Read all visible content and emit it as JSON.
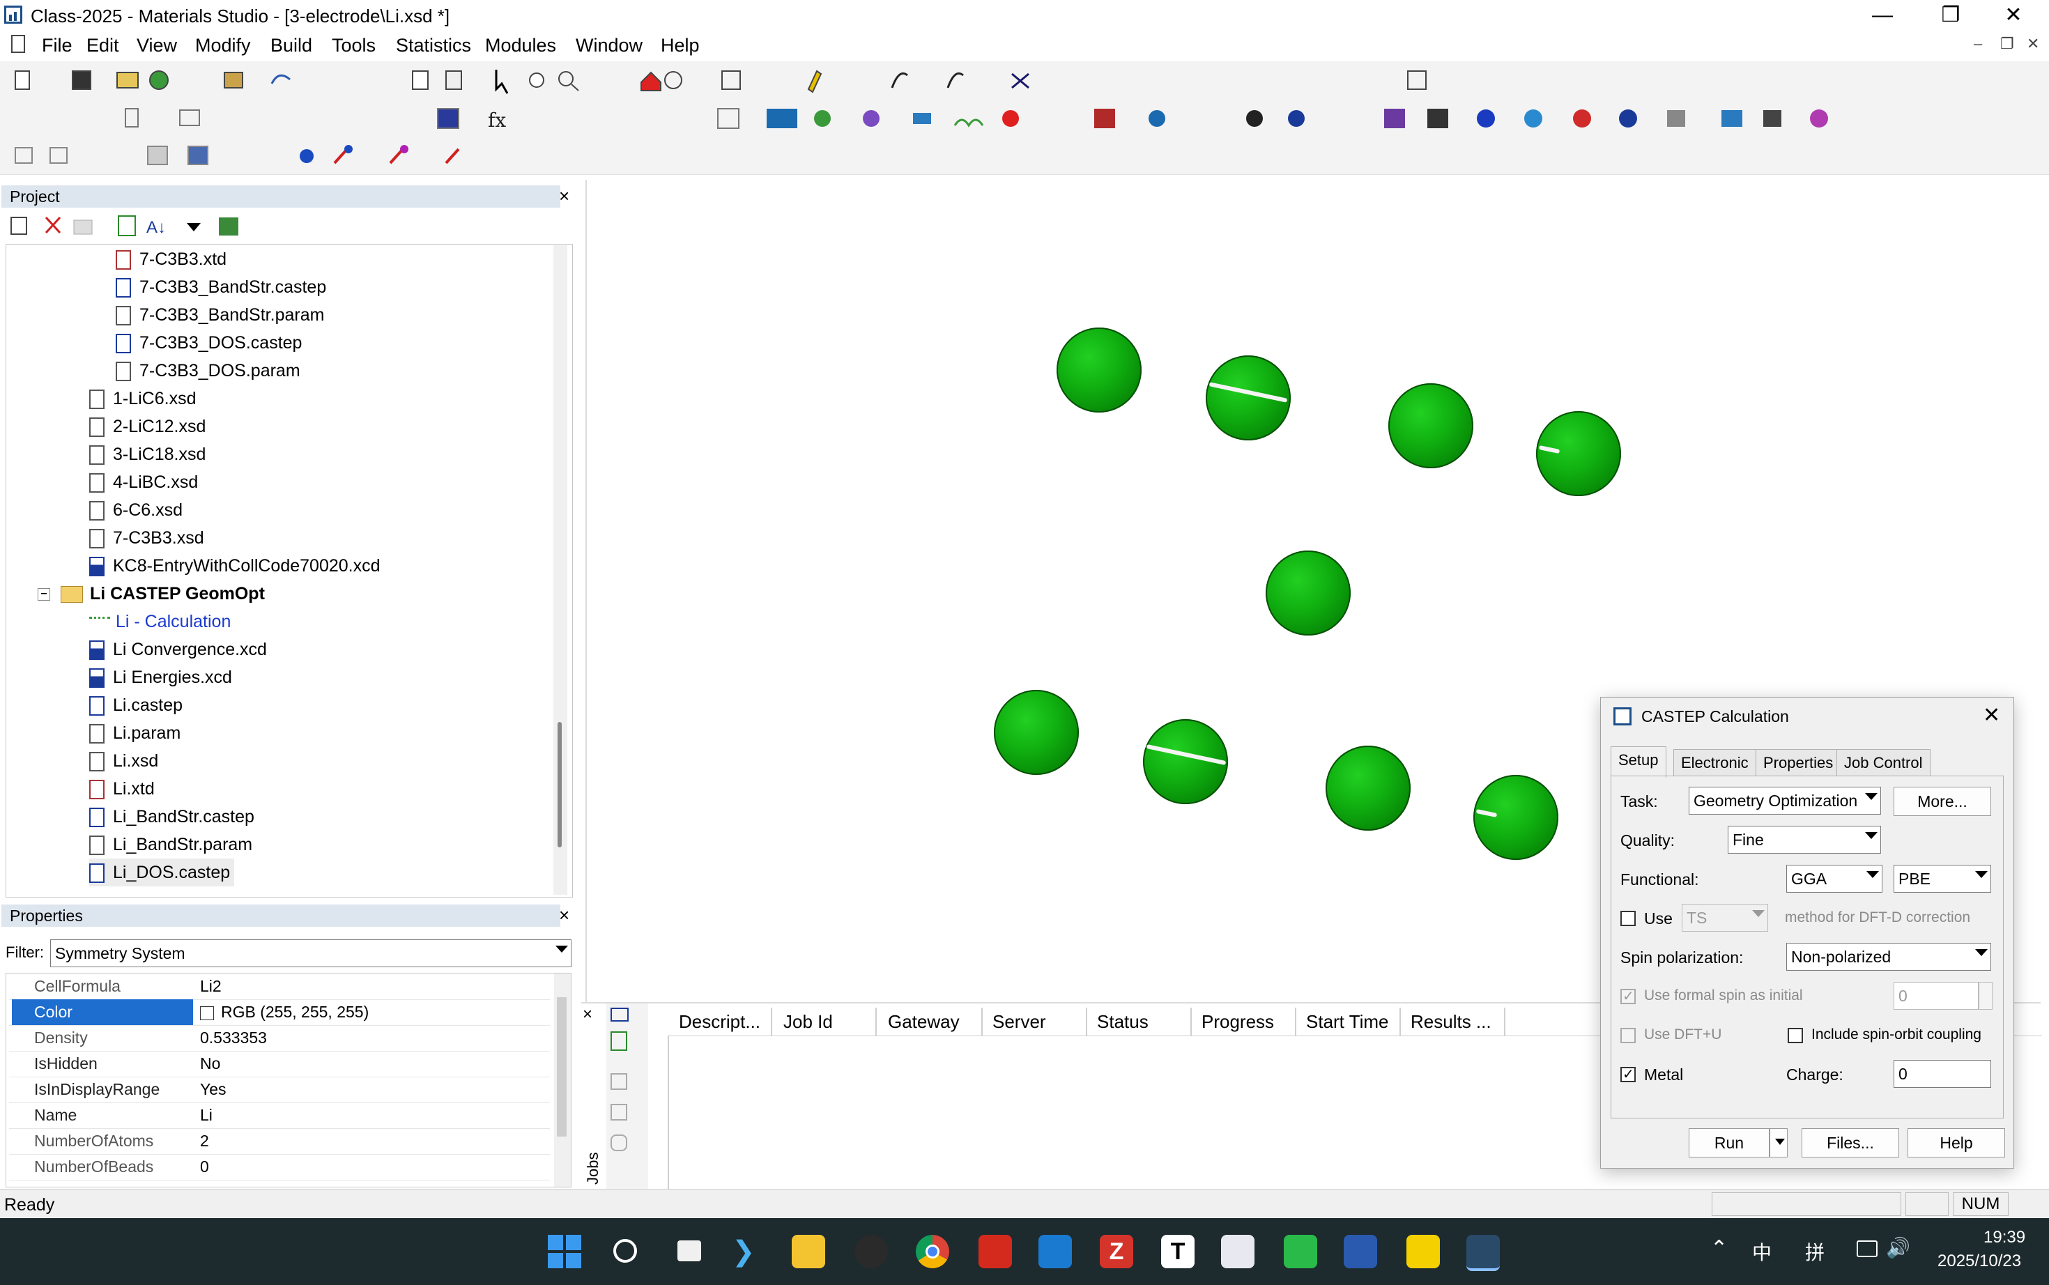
{
  "window": {
    "title": "Class-2025 - Materials Studio - [3-electrode\\Li.xsd *]"
  },
  "menu": [
    "File",
    "Edit",
    "View",
    "Modify",
    "Build",
    "Tools",
    "Statistics",
    "Modules",
    "Window",
    "Help"
  ],
  "project": {
    "header": "Project",
    "tree": [
      {
        "label": "7-C3B3.xtd"
      },
      {
        "label": "7-C3B3_BandStr.castep"
      },
      {
        "label": "7-C3B3_BandStr.param"
      },
      {
        "label": "7-C3B3_DOS.castep"
      },
      {
        "label": "7-C3B3_DOS.param"
      },
      {
        "label": "1-LiC6.xsd"
      },
      {
        "label": "2-LiC12.xsd"
      },
      {
        "label": "3-LiC18.xsd"
      },
      {
        "label": "4-LiBC.xsd"
      },
      {
        "label": "6-C6.xsd"
      },
      {
        "label": "7-C3B3.xsd"
      },
      {
        "label": "KC8-EntryWithCollCode70020.xcd"
      },
      {
        "label": "Li CASTEP GeomOpt"
      },
      {
        "label": "Li - Calculation"
      },
      {
        "label": "Li Convergence.xcd"
      },
      {
        "label": "Li Energies.xcd"
      },
      {
        "label": "Li.castep"
      },
      {
        "label": "Li.param"
      },
      {
        "label": "Li.xsd"
      },
      {
        "label": "Li.xtd"
      },
      {
        "label": "Li_BandStr.castep"
      },
      {
        "label": "Li_BandStr.param"
      },
      {
        "label": "Li_DOS.castep"
      }
    ]
  },
  "properties": {
    "header": "Properties",
    "filter_label": "Filter:",
    "filter_value": "Symmetry System",
    "rows": [
      {
        "name": "CellFormula",
        "value": "Li2"
      },
      {
        "name": "Color",
        "value": "RGB (255, 255, 255)"
      },
      {
        "name": "Density",
        "value": "0.533353"
      },
      {
        "name": "IsHidden",
        "value": "No"
      },
      {
        "name": "IsInDisplayRange",
        "value": "Yes"
      },
      {
        "name": "Name",
        "value": "Li"
      },
      {
        "name": "NumberOfAtoms",
        "value": "2"
      },
      {
        "name": "NumberOfBeads",
        "value": "0"
      }
    ]
  },
  "jobs": {
    "side_label": "Jobs",
    "columns": [
      "Descript...",
      "Job Id",
      "Gateway",
      "Server",
      "Status",
      "Progress",
      "Start Time",
      "Results ..."
    ]
  },
  "status": {
    "text": "Ready",
    "num": "NUM"
  },
  "dialog": {
    "title": "CASTEP Calculation",
    "tabs": [
      "Setup",
      "Electronic",
      "Properties",
      "Job Control"
    ],
    "task_label": "Task:",
    "task_value": "Geometry Optimization",
    "more_btn": "More...",
    "quality_label": "Quality:",
    "quality_value": "Fine",
    "functional_label": "Functional:",
    "functional_value": "GGA",
    "functional_sub": "PBE",
    "use_label": "Use",
    "dftd_value": "TS",
    "dftd_text": "method for DFT-D correction",
    "spin_label": "Spin polarization:",
    "spin_value": "Non-polarized",
    "formal_spin_label": "Use formal spin as initial",
    "formal_spin_value": "0",
    "dftu_label": "Use DFT+U",
    "soc_label": "Include spin-orbit coupling",
    "metal_label": "Metal",
    "charge_label": "Charge:",
    "charge_value": "0",
    "run_btn": "Run",
    "files_btn": "Files...",
    "help_btn": "Help"
  },
  "taskbar": {
    "clock": "19:39",
    "date": "2025/10/23",
    "ime1": "中",
    "ime2": "拼"
  }
}
